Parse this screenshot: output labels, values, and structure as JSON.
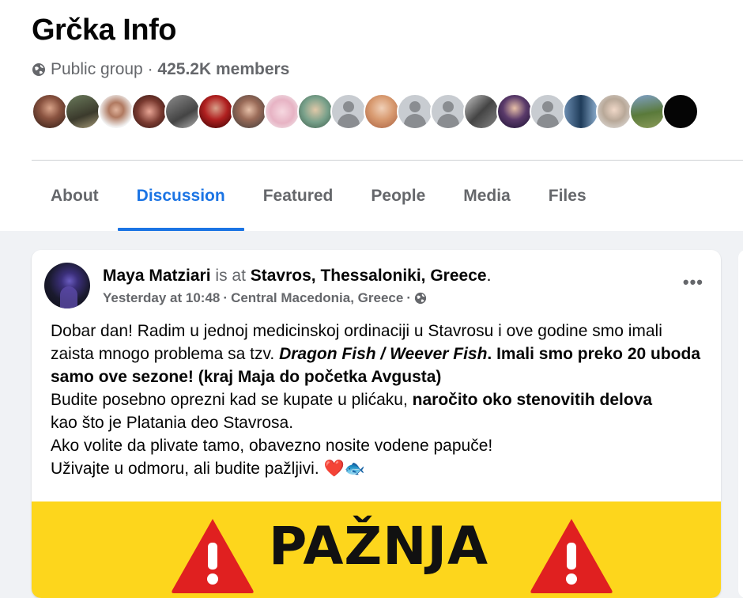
{
  "group": {
    "title": "Grčka Info",
    "privacy": "Public group",
    "separator": " · ",
    "members": "425.2K members"
  },
  "tabs": [
    {
      "label": "About"
    },
    {
      "label": "Discussion"
    },
    {
      "label": "Featured"
    },
    {
      "label": "People"
    },
    {
      "label": "Media"
    },
    {
      "label": "Files"
    }
  ],
  "post": {
    "author": "Maya Matziari",
    "is_at": " is at ",
    "place": "Stavros, Thessaloniki, Greece",
    "period": ".",
    "time": "Yesterday at 10:48",
    "location": "Central Macedonia, Greece",
    "dot": "·",
    "more": "•••",
    "body": {
      "l1": "Dobar dan! Radim u jednoj medicinskoj ordinaciji u Stavrosu i ove godine smo imali zaista mnogo problema sa tzv. ",
      "fish": "Dragon Fish / Weever Fish",
      "l1b": ". Imali smo preko 20 uboda samo ove sezone! (kraj Maja do početka Avgusta)",
      "l2a": "Budite posebno oprezni kad se kupate u plićaku, ",
      "l2b": "naročito oko stenovitih delova",
      "l2c": "kao što je Platania deo Stavrosa.",
      "l3": "Ako volite da plivate tamo, obavezno nosite vodene papuče!",
      "l4": "Uživajte u odmoru, ali budite pažljivi. ",
      "emoji": "❤️🐟"
    },
    "banner_text": "PAŽNJA"
  },
  "colors": {
    "accent": "#1b74e4",
    "banner": "#fdd61c",
    "warning_red": "#e02020"
  }
}
